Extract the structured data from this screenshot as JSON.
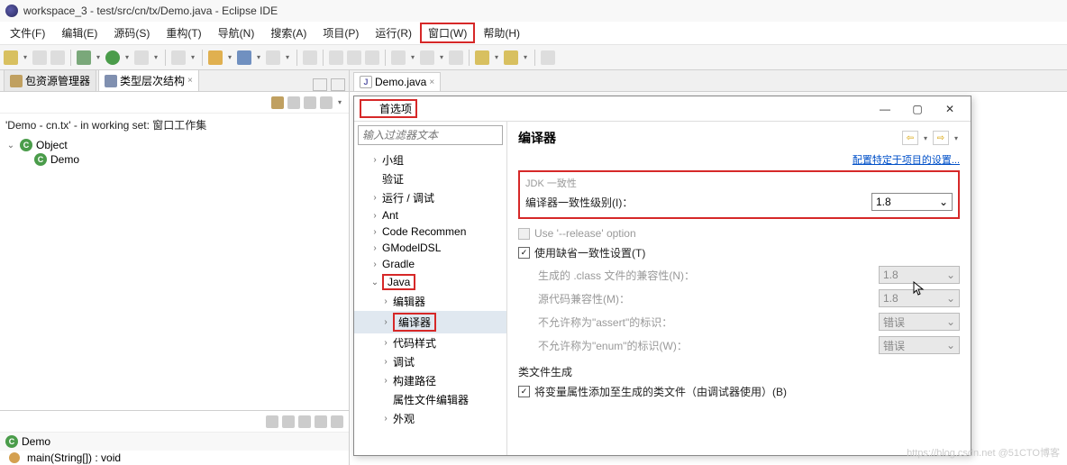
{
  "titlebar": {
    "text": "workspace_3 - test/src/cn/tx/Demo.java - Eclipse IDE"
  },
  "menubar": {
    "items": [
      "文件(F)",
      "编辑(E)",
      "源码(S)",
      "重构(T)",
      "导航(N)",
      "搜索(A)",
      "项目(P)",
      "运行(R)",
      "窗口(W)",
      "帮助(H)"
    ],
    "boxed_index": 8
  },
  "left_panel": {
    "tab1": "包资源管理器",
    "tab2": "类型层次结构",
    "info": "'Demo - cn.tx' - in working set: 窗口工作集",
    "tree_root": "Object",
    "tree_child": "Demo",
    "bottom_title": "Demo",
    "method": "main(String[]) : void"
  },
  "editor": {
    "tab": "Demo.java"
  },
  "prefs": {
    "title": "首选项",
    "filter_placeholder": "输入过滤器文本",
    "tree": [
      {
        "label": "小组",
        "arrow": ">",
        "indent": 1
      },
      {
        "label": "验证",
        "arrow": "",
        "indent": 1
      },
      {
        "label": "运行 / 调试",
        "arrow": ">",
        "indent": 1
      },
      {
        "label": "Ant",
        "arrow": ">",
        "indent": 1
      },
      {
        "label": "Code Recommen",
        "arrow": ">",
        "indent": 1
      },
      {
        "label": "GModelDSL",
        "arrow": ">",
        "indent": 1
      },
      {
        "label": "Gradle",
        "arrow": ">",
        "indent": 1
      },
      {
        "label": "Java",
        "arrow": "v",
        "indent": 1,
        "boxed": true
      },
      {
        "label": "编辑器",
        "arrow": ">",
        "indent": 2
      },
      {
        "label": "编译器",
        "arrow": ">",
        "indent": 2,
        "boxed": true,
        "sel": true
      },
      {
        "label": "代码样式",
        "arrow": ">",
        "indent": 2
      },
      {
        "label": "调试",
        "arrow": ">",
        "indent": 2
      },
      {
        "label": "构建路径",
        "arrow": ">",
        "indent": 2
      },
      {
        "label": "属性文件编辑器",
        "arrow": "",
        "indent": 2
      },
      {
        "label": "外观",
        "arrow": ">",
        "indent": 2
      }
    ],
    "header": "编译器",
    "config_link": "配置特定于项目的设置...",
    "jdk_section_title": "JDK 一致性",
    "compliance_label": "编译器一致性级别(I)：",
    "compliance_value": "1.8",
    "release_label": "Use '--release' option",
    "default_settings_label": "使用缺省一致性设置(T)",
    "class_compat_label": "生成的 .class 文件的兼容性(N)：",
    "class_compat_value": "1.8",
    "source_compat_label": "源代码兼容性(M)：",
    "source_compat_value": "1.8",
    "assert_label": "不允许称为\"assert\"的标识：",
    "assert_value": "错误",
    "enum_label": "不允许称为\"enum\"的标识(W)：",
    "enum_value": "错误",
    "classfile_section": "类文件生成",
    "add_var_label": "将变量属性添加至生成的类文件（由调试器使用）(B)"
  },
  "watermark": "https://blog.csdn.net @51CTO博客"
}
